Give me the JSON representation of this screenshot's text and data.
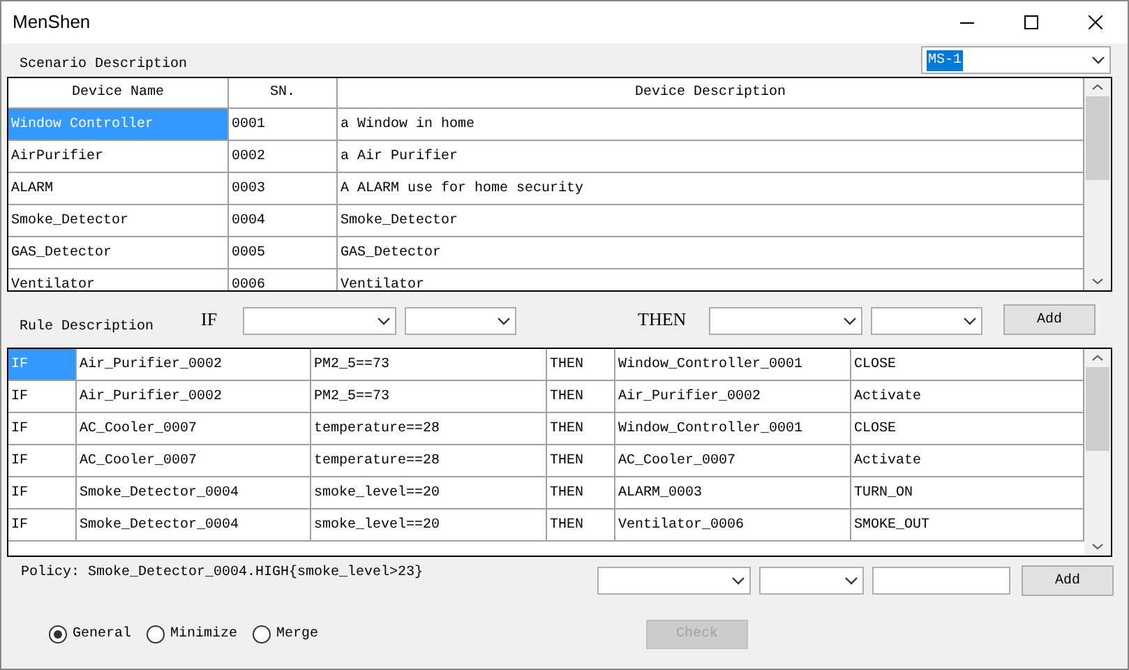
{
  "window": {
    "title": "MenShen"
  },
  "scenario": {
    "label": "Scenario Description",
    "combo": {
      "value": "MS-1",
      "highlighted": true
    }
  },
  "devices": {
    "columns": [
      "Device Name",
      "SN.",
      "Device Description"
    ],
    "rows": [
      {
        "cells": [
          "Window Controller",
          "0001",
          "a Window in home"
        ],
        "selected": true
      },
      {
        "cells": [
          "AirPurifier",
          "0002",
          "a Air Purifier"
        ],
        "selected": false
      },
      {
        "cells": [
          "ALARM",
          "0003",
          "A ALARM use for home security"
        ],
        "selected": false
      },
      {
        "cells": [
          "Smoke_Detector",
          "0004",
          "Smoke_Detector"
        ],
        "selected": false
      },
      {
        "cells": [
          "GAS_Detector",
          "0005",
          "GAS_Detector"
        ],
        "selected": false
      },
      {
        "cells": [
          "Ventilator",
          "0006",
          "Ventilator"
        ],
        "selected": false
      }
    ]
  },
  "rule_builder": {
    "label": "Rule Description",
    "if_label": "IF",
    "then_label": "THEN",
    "add_button": "Add"
  },
  "rules": {
    "rows": [
      {
        "cells": [
          "IF",
          "Air_Purifier_0002",
          "PM2_5==73",
          "THEN",
          "Window_Controller_0001",
          "CLOSE"
        ],
        "selected": true
      },
      {
        "cells": [
          "IF",
          "Air_Purifier_0002",
          "PM2_5==73",
          "THEN",
          "Air_Purifier_0002",
          "Activate"
        ],
        "selected": false
      },
      {
        "cells": [
          "IF",
          "AC_Cooler_0007",
          "temperature==28",
          "THEN",
          "Window_Controller_0001",
          "CLOSE"
        ],
        "selected": false
      },
      {
        "cells": [
          "IF",
          "AC_Cooler_0007",
          "temperature==28",
          "THEN",
          "AC_Cooler_0007",
          "Activate"
        ],
        "selected": false
      },
      {
        "cells": [
          "IF",
          "Smoke_Detector_0004",
          "smoke_level==20",
          "THEN",
          "ALARM_0003",
          "TURN_ON"
        ],
        "selected": false
      },
      {
        "cells": [
          "IF",
          "Smoke_Detector_0004",
          "smoke_level==20",
          "THEN",
          "Ventilator_0006",
          "SMOKE_OUT"
        ],
        "selected": false
      }
    ]
  },
  "policy": {
    "text": "Policy: Smoke_Detector_0004.HIGH{smoke_level>23}",
    "add_button": "Add"
  },
  "modes": [
    {
      "label": "General",
      "selected": true
    },
    {
      "label": "Minimize",
      "selected": false
    },
    {
      "label": "Merge",
      "selected": false
    }
  ],
  "check_button": {
    "label": "Check",
    "disabled": true
  }
}
